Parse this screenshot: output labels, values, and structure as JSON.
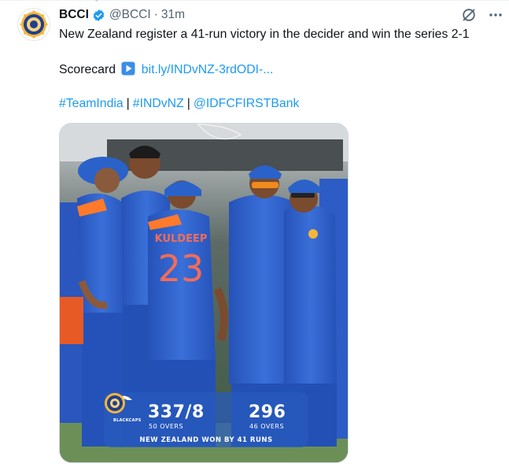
{
  "tweet": {
    "author_name": "BCCI",
    "author_handle": "@BCCI",
    "separator": "·",
    "timestamp": "31m",
    "verified_icon": "verified-badge-icon",
    "body_line": "New Zealand register a 41-run victory in the decider and win the series 2-1",
    "scorecard_label": "Scorecard",
    "scorecard_icon": "play-button-emoji",
    "scorecard_link": "bit.ly/INDvNZ-3rdODI-...",
    "hashtags": [
      "#TeamIndia",
      "#INDvNZ",
      "@IDFCFIRSTBank"
    ],
    "hashtag_separator": "|"
  },
  "header_icons": [
    "grok-icon",
    "more-icon"
  ],
  "media": {
    "alt": "India team huddle",
    "jersey_name": "KULDEEP",
    "jersey_number": "23",
    "scoreboard": {
      "team1_logo": "blackcaps-logo",
      "team1_label": "BLACKCAPS",
      "team1_score": "337/8",
      "team1_overs": "50 OVERS",
      "team2_logo": "bcci-crest",
      "team2_score": "296",
      "team2_overs": "46 OVERS",
      "result": "NEW ZEALAND WON BY 41 RUNS"
    }
  },
  "colors": {
    "link": "#1d9bf0",
    "verified": "#1d9bf0",
    "text": "#0f1419",
    "secondary": "#536471",
    "jersey": "#2f5fc9",
    "scoreboard_bg": "#2f5ab8"
  }
}
